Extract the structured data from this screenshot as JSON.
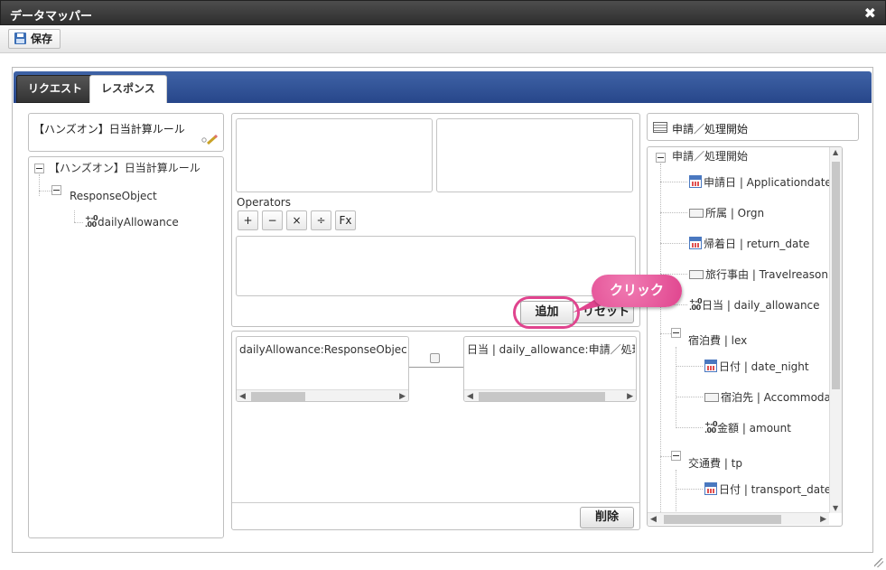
{
  "window": {
    "title": "データマッパー"
  },
  "toolbar": {
    "save_label": "保存"
  },
  "tabs": [
    {
      "label": "リクエスト"
    },
    {
      "label": "レスポンス"
    }
  ],
  "left": {
    "header": "【ハンズオン】日当計算ルール",
    "root": "【ハンズオン】日当計算ルール",
    "child": "ResponseObject",
    "leaf": "dailyAllowance",
    "num_icon_top": "+-0",
    "num_icon_bottom": ".00"
  },
  "center": {
    "operators_label": "Operators",
    "operators": [
      "+",
      "−",
      "×",
      "÷",
      "Fx"
    ],
    "add_label": "追加",
    "reset_label": "リセット",
    "mapping_left": "dailyAllowance:ResponseObject.【ハンズオン】日当計算ルール",
    "mapping_right": "日当 | daily_allowance:申請／処理開始",
    "delete_label": "削除"
  },
  "right": {
    "header": "申請／処理開始",
    "root": "申請／処理開始",
    "items": [
      "申請日 | Applicationdate",
      "所属 | Orgn",
      "帰着日 | return_date",
      "旅行事由 | Travelreason",
      "日当 | daily_allowance",
      "宿泊費 | lex",
      "日付 | date_night",
      "宿泊先 | Accommodation",
      "金額 | amount",
      "交通費 | tp",
      "日付 | transport_date"
    ]
  },
  "callout": {
    "label": "クリック"
  },
  "colors": {
    "accent": "#2f4f95",
    "callout": "#e0448e"
  }
}
